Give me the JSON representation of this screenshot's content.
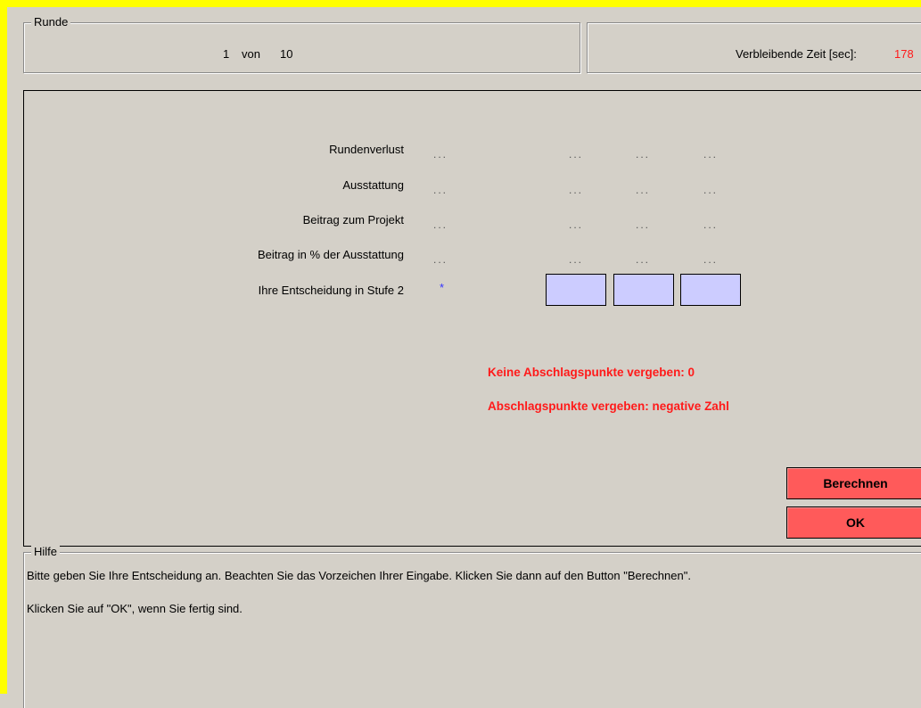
{
  "colors": {
    "frame_highlight": "#ffff00",
    "panel_bg": "#d4d0c8",
    "input_bg": "#ccccff",
    "button_bg": "#ff5a5a",
    "warning_text": "#ff1a1a",
    "timer_value": "#ff1a1a",
    "asterisk": "#3333ff"
  },
  "round_box": {
    "legend": "Runde",
    "current": "1",
    "of_label": "von",
    "total": "10"
  },
  "timer_box": {
    "label": "Verbleibende Zeit [sec]:",
    "value": "178"
  },
  "table": {
    "rows": [
      {
        "label": "Rundenverlust",
        "own": "...",
        "others": [
          "...",
          "...",
          "..."
        ]
      },
      {
        "label": "Ausstattung",
        "own": "...",
        "others": [
          "...",
          "...",
          "..."
        ]
      },
      {
        "label": "Beitrag zum Projekt",
        "own": "...",
        "others": [
          "...",
          "...",
          "..."
        ]
      },
      {
        "label": "Beitrag in % der Ausstattung",
        "own": "...",
        "others": [
          "...",
          "...",
          "..."
        ]
      }
    ],
    "decision": {
      "label": "Ihre Entscheidung in Stufe 2",
      "marker": "*",
      "inputs": [
        "",
        "",
        ""
      ]
    }
  },
  "notices": {
    "line1": "Keine Abschlagspunkte vergeben: 0",
    "line2": "Abschlagspunkte vergeben: negative Zahl"
  },
  "buttons": {
    "calculate": "Berechnen",
    "ok": "OK"
  },
  "help": {
    "legend": "Hilfe",
    "line1": "Bitte geben Sie Ihre Entscheidung an. Beachten Sie das Vorzeichen Ihrer Eingabe. Klicken Sie dann auf den Button \"Berechnen\".",
    "line2": "Klicken Sie auf \"OK\", wenn Sie fertig sind."
  }
}
